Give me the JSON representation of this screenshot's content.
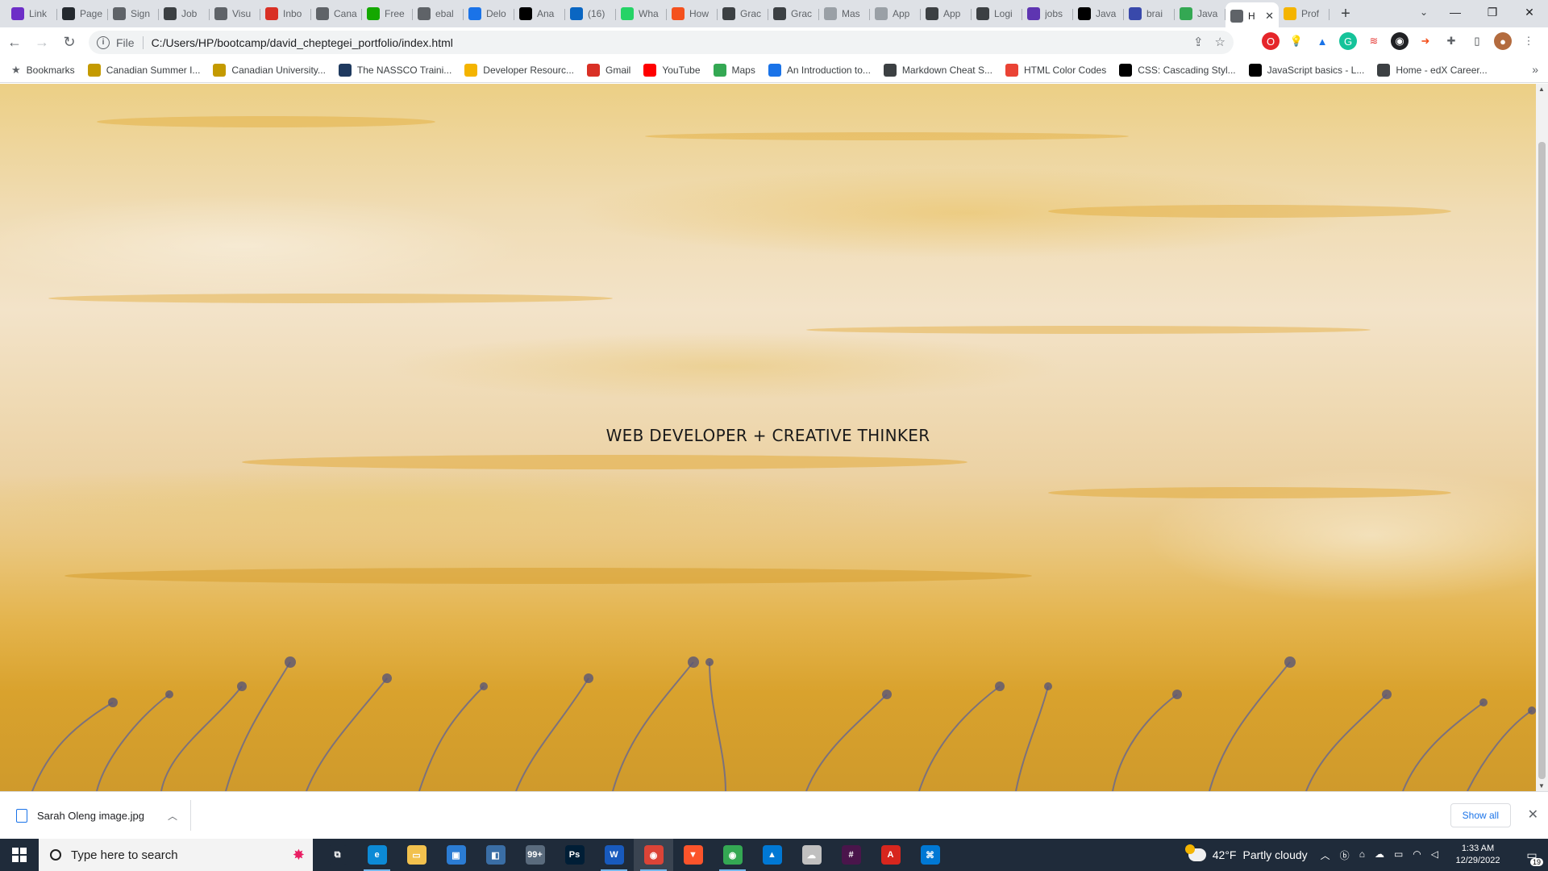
{
  "browser": {
    "tabs": [
      {
        "title": "Link",
        "icon": "brand-b-icon",
        "color": "#6d2ec7"
      },
      {
        "title": "Page",
        "icon": "github-icon",
        "color": "#24292e"
      },
      {
        "title": "Sign",
        "icon": "globe-icon",
        "color": "#5f6368"
      },
      {
        "title": "Job",
        "icon": "job-icon",
        "color": "#3c4043"
      },
      {
        "title": "Visu",
        "icon": "globe-icon",
        "color": "#5f6368"
      },
      {
        "title": "Inbo",
        "icon": "gmail-icon",
        "color": "#d93025"
      },
      {
        "title": "Cana",
        "icon": "globe-icon",
        "color": "#5f6368"
      },
      {
        "title": "Free",
        "icon": "upwork-icon",
        "color": "#14a800"
      },
      {
        "title": "ebal",
        "icon": "globe-icon",
        "color": "#5f6368"
      },
      {
        "title": "Delo",
        "icon": "fw-icon",
        "color": "#1a73e8"
      },
      {
        "title": "Ana",
        "icon": "d-icon",
        "color": "#000000"
      },
      {
        "title": "(16)",
        "icon": "linkedin-icon",
        "color": "#0a66c2"
      },
      {
        "title": "Wha",
        "icon": "whatsapp-icon",
        "color": "#25d366"
      },
      {
        "title": "How",
        "icon": "medium-icon",
        "color": "#f4511e"
      },
      {
        "title": "Grac",
        "icon": "grad-icon",
        "color": "#3c4043"
      },
      {
        "title": "Grac",
        "icon": "grad-icon",
        "color": "#3c4043"
      },
      {
        "title": "Mas",
        "icon": "elc-icon",
        "color": "#9aa0a6"
      },
      {
        "title": "App",
        "icon": "elc-icon",
        "color": "#9aa0a6"
      },
      {
        "title": "App",
        "icon": "grad-icon",
        "color": "#3c4043"
      },
      {
        "title": "Logi",
        "icon": "grad-icon",
        "color": "#3c4043"
      },
      {
        "title": "jobs",
        "icon": "peace-icon",
        "color": "#5e35b1"
      },
      {
        "title": "Java",
        "icon": "code-icon",
        "color": "#000000"
      },
      {
        "title": "brai",
        "icon": "brain-icon",
        "color": "#3949ab"
      },
      {
        "title": "Java",
        "icon": "w-icon",
        "color": "#34a853"
      },
      {
        "title": "H",
        "icon": "globe-icon",
        "color": "#5f6368",
        "active": true
      },
      {
        "title": "Prof",
        "icon": "fs-icon",
        "color": "#f4b400"
      }
    ],
    "new_tab_label": "+",
    "url_scheme": "File",
    "url": "C:/Users/HP/bootcamp/david_cheptegei_portfolio/index.html",
    "bookmarks_label": "Bookmarks",
    "bookmarks": [
      {
        "label": "Canadian Summer I...",
        "icon": "canada-icon",
        "color": "#c49a00"
      },
      {
        "label": "Canadian University...",
        "icon": "canada-icon",
        "color": "#c49a00"
      },
      {
        "label": "The NASSCO Traini...",
        "icon": "nassco-icon",
        "color": "#1f3a5f"
      },
      {
        "label": "Developer Resourc...",
        "icon": "fs-icon",
        "color": "#f4b400"
      },
      {
        "label": "Gmail",
        "icon": "gmail-icon",
        "color": "#d93025"
      },
      {
        "label": "YouTube",
        "icon": "youtube-icon",
        "color": "#ff0000"
      },
      {
        "label": "Maps",
        "icon": "maps-icon",
        "color": "#34a853"
      },
      {
        "label": "An Introduction to...",
        "icon": "play-icon",
        "color": "#1a73e8"
      },
      {
        "label": "Markdown Cheat S...",
        "icon": "markdown-icon",
        "color": "#3c4043"
      },
      {
        "label": "HTML Color Codes",
        "icon": "color-icon",
        "color": "#ea4335"
      },
      {
        "label": "CSS: Cascading Styl...",
        "icon": "mdn-icon",
        "color": "#000000"
      },
      {
        "label": "JavaScript basics - L...",
        "icon": "mdn-icon",
        "color": "#000000"
      },
      {
        "label": "Home - edX Career...",
        "icon": "edx-icon",
        "color": "#3c4043"
      }
    ]
  },
  "page": {
    "hero_text": "WEB DEVELOPER + CREATIVE THINKER"
  },
  "downloads": {
    "file_name": "Sarah Oleng image.jpg",
    "show_all_label": "Show all"
  },
  "taskbar": {
    "search_placeholder": "Type here to search",
    "apps": [
      {
        "name": "task-view-icon",
        "label": "⧉",
        "color": "#1f2b3a"
      },
      {
        "name": "edge-icon",
        "label": "e",
        "color": "#0c8ad6"
      },
      {
        "name": "file-explorer-icon",
        "label": "▭",
        "color": "#f2c14e"
      },
      {
        "name": "store-icon",
        "label": "▣",
        "color": "#2b7cd3"
      },
      {
        "name": "app-icon",
        "label": "◧",
        "color": "#3a6ea5"
      },
      {
        "name": "mail-badge-icon",
        "label": "99+",
        "color": "#5a6b7d"
      },
      {
        "name": "photoshop-icon",
        "label": "Ps",
        "color": "#001e36"
      },
      {
        "name": "word-icon",
        "label": "W",
        "color": "#185abd"
      },
      {
        "name": "chrome-icon",
        "label": "◉",
        "color": "#db4437"
      },
      {
        "name": "brave-icon",
        "label": "▼",
        "color": "#fb542b"
      },
      {
        "name": "chrome-profile-icon",
        "label": "◉",
        "color": "#34a853"
      },
      {
        "name": "photos-icon",
        "label": "▲",
        "color": "#0078d4"
      },
      {
        "name": "feedback-icon",
        "label": "☁",
        "color": "#c0c0c0"
      },
      {
        "name": "slack-icon",
        "label": "#",
        "color": "#4a154b"
      },
      {
        "name": "acrobat-icon",
        "label": "A",
        "color": "#d7261e"
      },
      {
        "name": "vscode-icon",
        "label": "⌘",
        "color": "#0078d4"
      }
    ],
    "weather_temp": "42°F",
    "weather_desc": "Partly cloudy",
    "time": "1:33 AM",
    "date": "12/29/2022",
    "notification_count": "19"
  }
}
